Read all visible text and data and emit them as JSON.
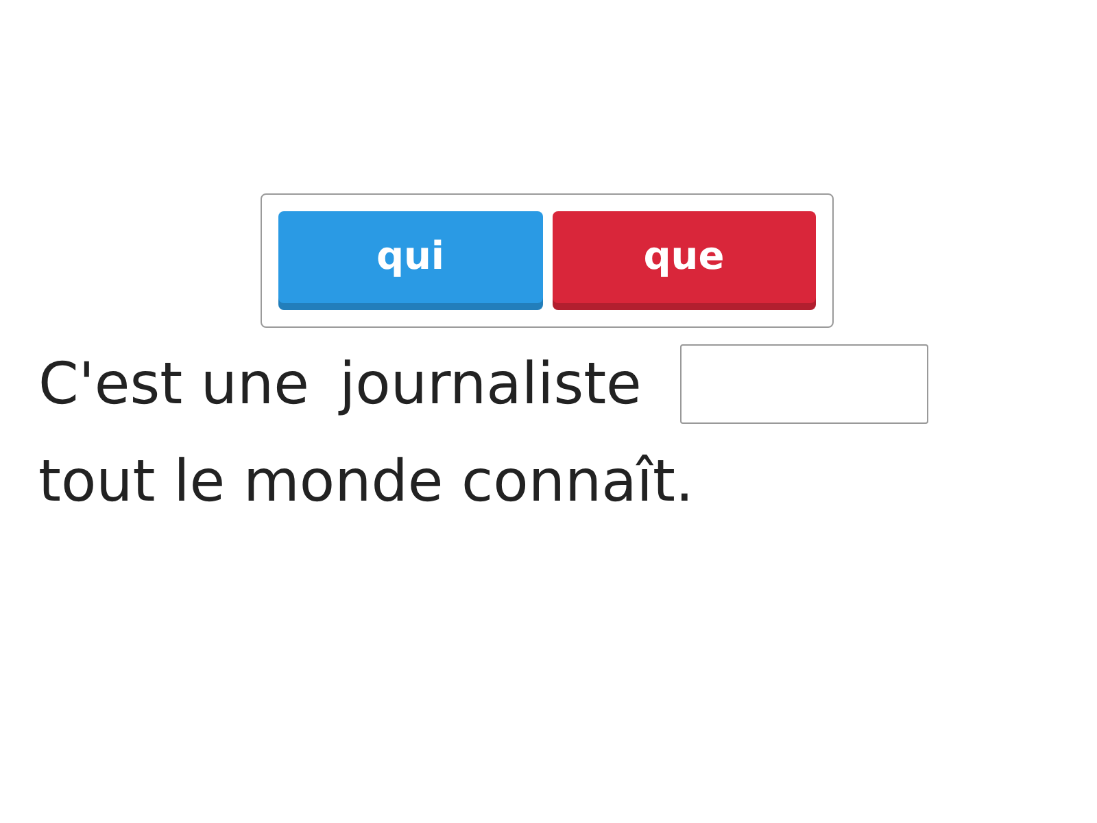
{
  "choices": [
    {
      "label": "qui",
      "color": "#2a9ae4"
    },
    {
      "label": "que",
      "color": "#d9263a"
    }
  ],
  "sentence": [
    {
      "kind": "text",
      "text": "C'est une"
    },
    {
      "kind": "text",
      "text": "journaliste"
    },
    {
      "kind": "blank"
    },
    {
      "kind": "text",
      "text": "tout le monde connaît."
    }
  ]
}
